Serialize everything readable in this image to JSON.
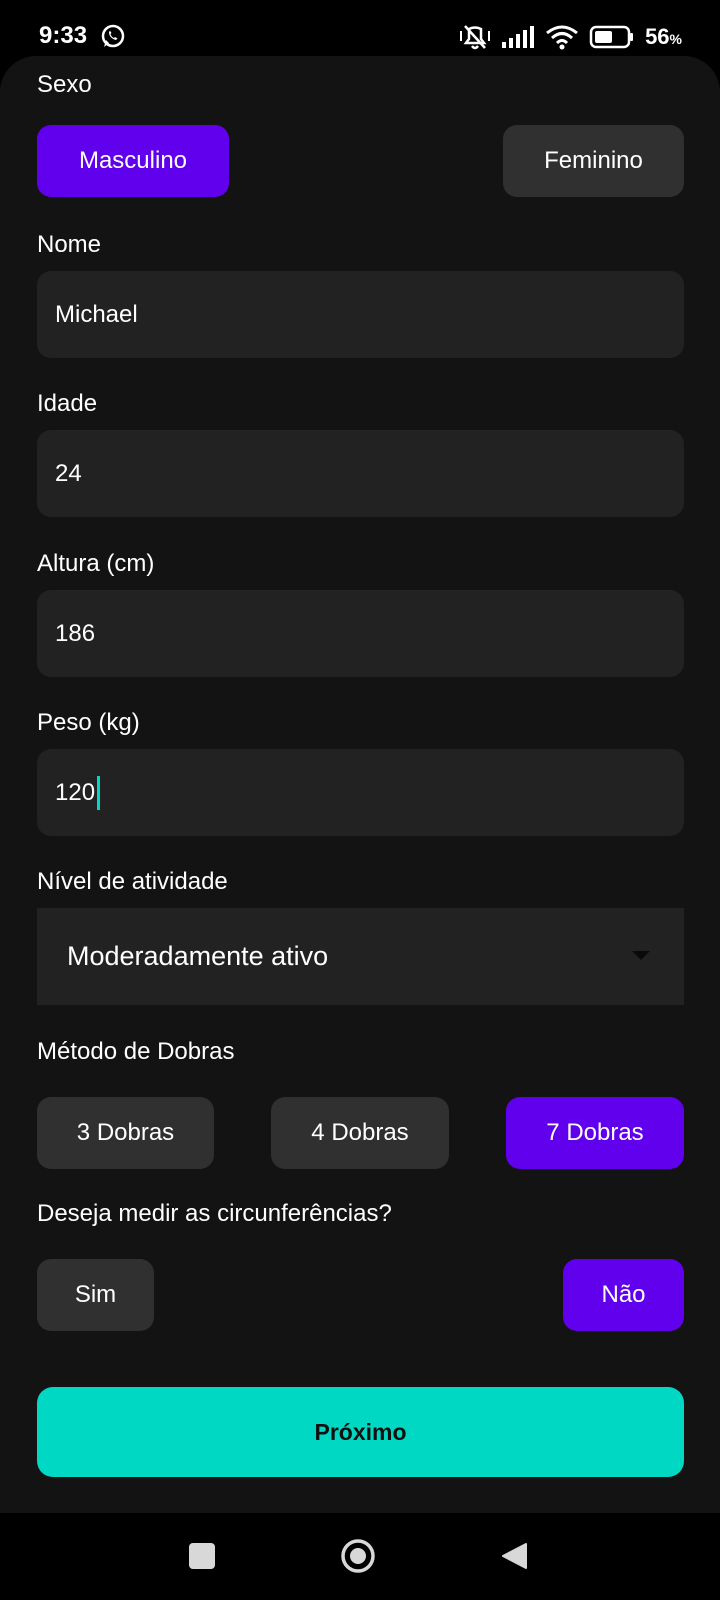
{
  "status_bar": {
    "time": "9:33",
    "battery_percent": "56",
    "battery_unit": "%",
    "icons": [
      "whatsapp-icon",
      "mute-vibrate-icon",
      "signal-icon",
      "wifi-icon",
      "battery-icon"
    ]
  },
  "form": {
    "sex": {
      "label": "Sexo",
      "options": [
        "Masculino",
        "Feminino"
      ],
      "selected": "Masculino"
    },
    "name": {
      "label": "Nome",
      "value": "Michael"
    },
    "age": {
      "label": "Idade",
      "value": "24"
    },
    "height": {
      "label": "Altura (cm)",
      "value": "186"
    },
    "weight": {
      "label": "Peso (kg)",
      "value": "120"
    },
    "activity": {
      "label": "Nível de atividade",
      "value": "Moderadamente ativo"
    },
    "method": {
      "label": "Método de Dobras",
      "options": [
        "3 Dobras",
        "4 Dobras",
        "7 Dobras"
      ],
      "selected": "7 Dobras"
    },
    "circumference": {
      "label": "Deseja medir as circunferências?",
      "options": [
        "Sim",
        "Não"
      ],
      "selected": "Não"
    },
    "next_label": "Próximo"
  },
  "colors": {
    "accent_purple": "#6100ed",
    "accent_teal": "#00d8c3",
    "card_background": "#131313",
    "field_background": "#222222",
    "unselected_button": "#303030"
  },
  "nav_bar": {
    "icons": [
      "recents-square-icon",
      "home-circle-icon",
      "back-triangle-icon"
    ]
  }
}
